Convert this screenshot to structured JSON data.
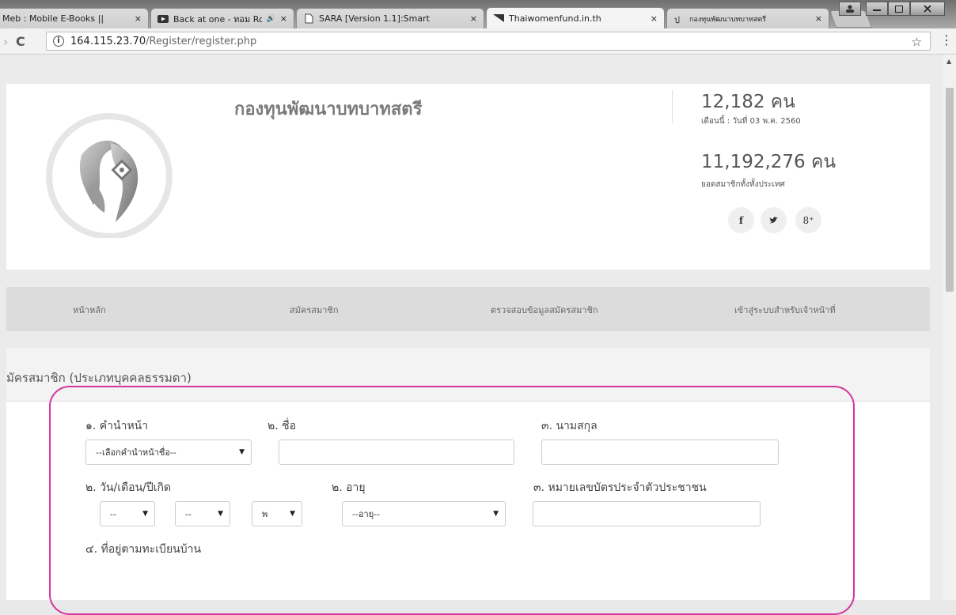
{
  "browser": {
    "tabs": [
      {
        "label": "Meb : Mobile E-Books || ",
        "close": "×",
        "favicon": "none"
      },
      {
        "label": "Back at one - ทอม Roc",
        "close": "×",
        "favicon": "youtube-icon",
        "audio": "🔊"
      },
      {
        "label": "SARA [Version 1.1]:Smart",
        "close": "×",
        "favicon": "page-icon"
      },
      {
        "label": "Thaiwomenfund.in.th",
        "close": "×",
        "favicon": "flag-icon",
        "active": true
      },
      {
        "label": "กองทุนพัฒนาบทบาทสตรี",
        "close": "×",
        "favicon": "site-icon"
      }
    ],
    "url_host": "164.115.23.70",
    "url_path": "/Register/register.php",
    "info_symbol": "i",
    "reload_symbol": "C",
    "star_symbol": "☆",
    "menu_symbol": "⋮"
  },
  "header": {
    "site_title": "กองทุนพัฒนาบทบาทสตรี",
    "stat_month_value": "12,182 คน",
    "stat_month_caption": "เดือนนี้ : วันที่ 03 พ.ค. 2560",
    "stat_total_value": "11,192,276 คน",
    "stat_total_caption": "ยอดสมาชิกทั้งทั้งประเทศ",
    "social": {
      "facebook": "f",
      "twitter": "🐦",
      "googleplus": "8⁺"
    }
  },
  "nav": {
    "home": "หน้าหลัก",
    "register": "สมัครสมาชิก",
    "check": "ตรวจสอบข้อมูลสมัครสมาชิก",
    "staff_login": "เข้าสู่ระบบสำหรับเจ้าหน้าที่"
  },
  "form": {
    "section_title": "มัครสมาชิก (ประเภทบุคคลธรรมดา)",
    "title_label": "๑. คำนำหน้า",
    "title_select": "--เลือกคำนำหน้าชื่อ--",
    "firstname_label": "๒. ชื่อ",
    "lastname_label": "๓. นามสกุล",
    "birthdate_label": "๒. วัน/เดือน/ปีเกิด",
    "day_select": "--",
    "month_select": "--",
    "year_select": "พ",
    "age_label": "๒. อายุ",
    "age_select": "--อายุ--",
    "idcard_label": "๓. หมายเลขบัตรประจำตัวประชาชน",
    "address_label": "๔. ที่อยู่ตามทะเบียนบ้าน",
    "caret": "▼"
  },
  "colors": {
    "highlight": "#d6359c",
    "nav_bg": "#dcdcdc"
  }
}
